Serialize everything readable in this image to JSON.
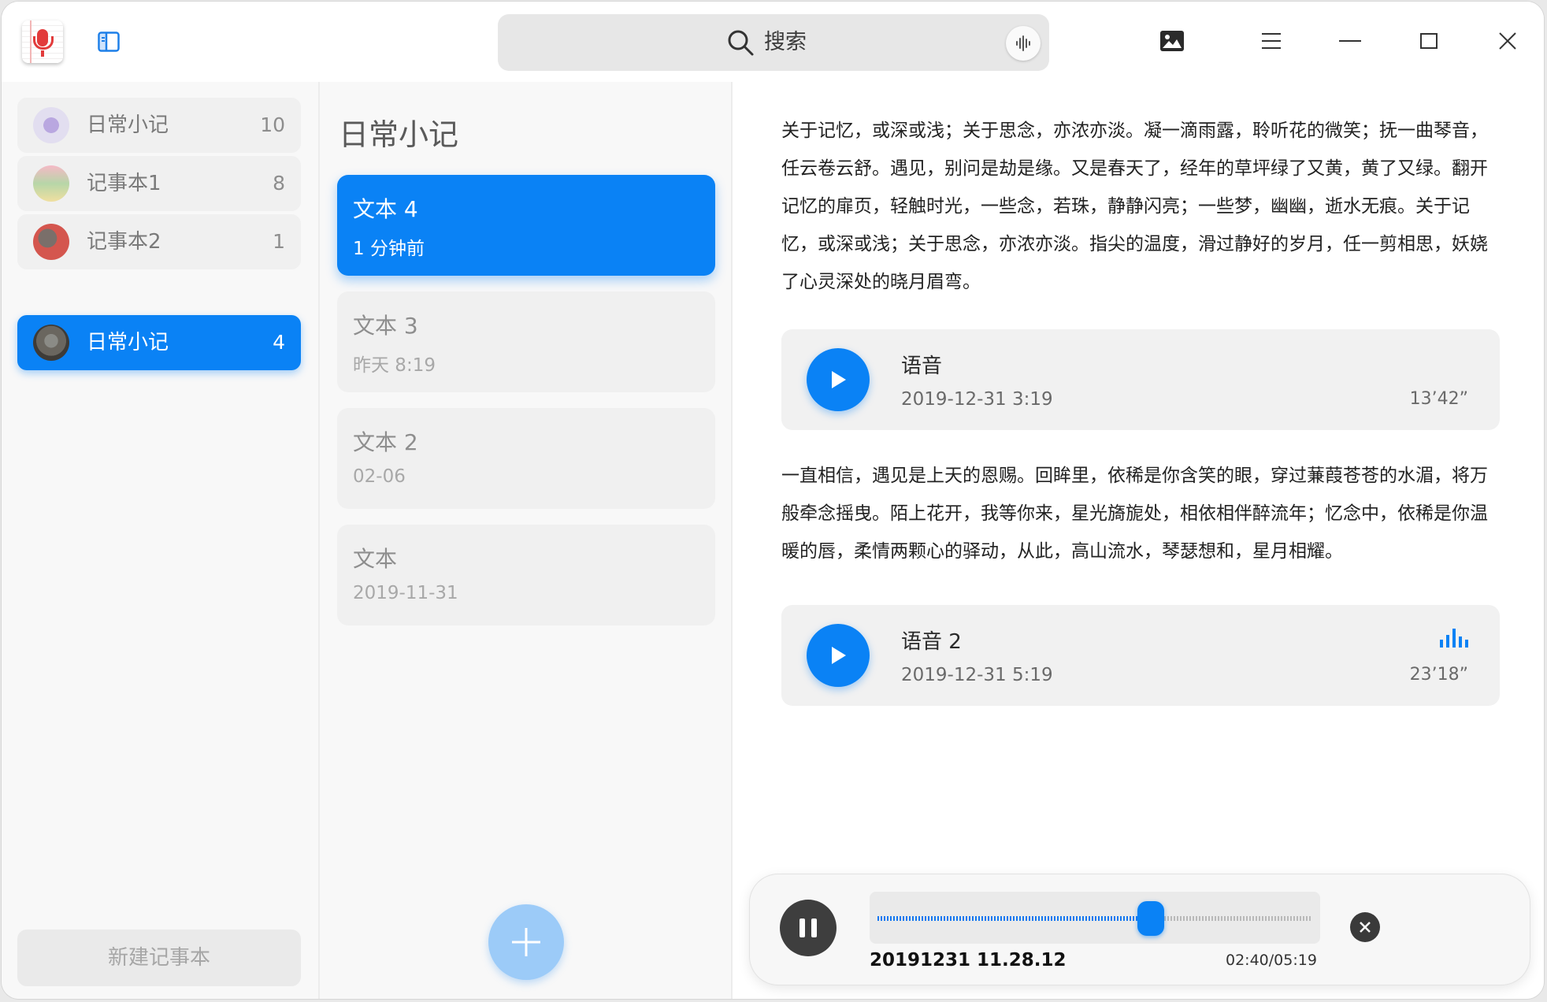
{
  "titlebar": {
    "search_placeholder": "搜索",
    "icons": [
      "app-voice-notes-icon",
      "sidebar-toggle-icon",
      "search-icon",
      "voice-input-icon",
      "image-icon",
      "menu-icon",
      "minimize-icon",
      "maximize-icon",
      "close-icon"
    ]
  },
  "sidebar": {
    "items": [
      {
        "label": "日常小记",
        "count": "10",
        "active": false
      },
      {
        "label": "记事本1",
        "count": "8",
        "active": false
      },
      {
        "label": "记事本2",
        "count": "1",
        "active": false
      },
      {
        "label": "日常小记",
        "count": "4",
        "active": true
      }
    ],
    "new_notebook_label": "新建记事本"
  },
  "notes_list": {
    "title": "日常小记",
    "notes": [
      {
        "title": "文本 4",
        "date": "1 分钟前",
        "active": true
      },
      {
        "title": "文本 3",
        "date": "昨天  8:19",
        "active": false
      },
      {
        "title": "文本 2",
        "date": "02-06",
        "active": false
      },
      {
        "title": "文本",
        "date": "2019-11-31",
        "active": false
      }
    ]
  },
  "content": {
    "paragraph1": "关于记忆，或深或浅；关于思念，亦浓亦淡。凝一滴雨露，聆听花的微笑；抚一曲琴音，任云卷云舒。遇见，别问是劫是缘。又是春天了，经年的草坪绿了又黄，黄了又绿。翻开记忆的扉页，轻触时光，一些念，若珠，静静闪亮；一些梦，幽幽，逝水无痕。关于记忆，或深或浅；关于思念，亦浓亦淡。指尖的温度，滑过静好的岁月，任一剪相思，妖娆了心灵深处的晓月眉弯。",
    "voice1": {
      "title": "语音",
      "date": "2019-12-31   3:19",
      "length": "13’42”"
    },
    "paragraph2": "一直相信，遇见是上天的恩赐。回眸里，依稀是你含笑的眼，穿过蒹葭苍苍的水湄，将万般牵念摇曳。陌上花开，我等你来，星光旖旎处，相依相伴醉流年；忆念中，依稀是你温暖的唇，柔情两颗心的驿动，从此，高山流水，琴瑟想和，星月相耀。",
    "voice2": {
      "title": "语音 2",
      "date": "2019-12-31   5:19",
      "length": "23’18”"
    }
  },
  "player": {
    "recording_name": "20191231 11.28.12",
    "time": "02:40/05:19",
    "progress": 0.5
  },
  "colors": {
    "accent": "#0a82f5",
    "add_button": "#9ccbf8",
    "panel_bg": "#f8f8f8"
  }
}
